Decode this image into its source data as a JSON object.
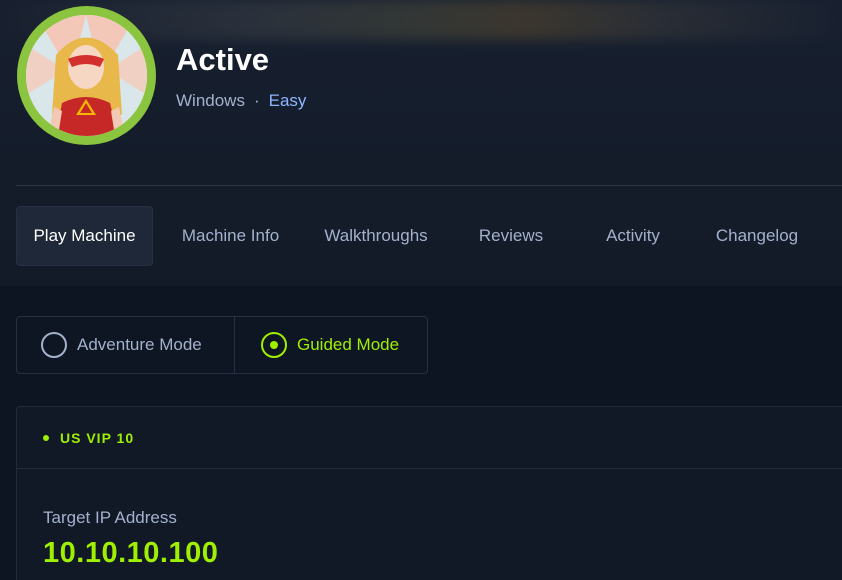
{
  "machine": {
    "name": "Active",
    "os": "Windows",
    "separator": "·",
    "difficulty": "Easy"
  },
  "tabs": [
    {
      "label": "Play Machine",
      "active": true
    },
    {
      "label": "Machine Info",
      "active": false
    },
    {
      "label": "Walkthroughs",
      "active": false
    },
    {
      "label": "Reviews",
      "active": false
    },
    {
      "label": "Activity",
      "active": false
    },
    {
      "label": "Changelog",
      "active": false
    }
  ],
  "modes": {
    "adventure_label": "Adventure Mode",
    "guided_label": "Guided Mode",
    "selected": "guided"
  },
  "server": {
    "name": "US VIP 10",
    "ip_label": "Target IP Address",
    "ip_value": "10.10.10.100"
  },
  "colors": {
    "accent": "#9fef00",
    "background": "#111927",
    "muted_text": "#a4b1cd",
    "difficulty": "#8fb6ff"
  }
}
